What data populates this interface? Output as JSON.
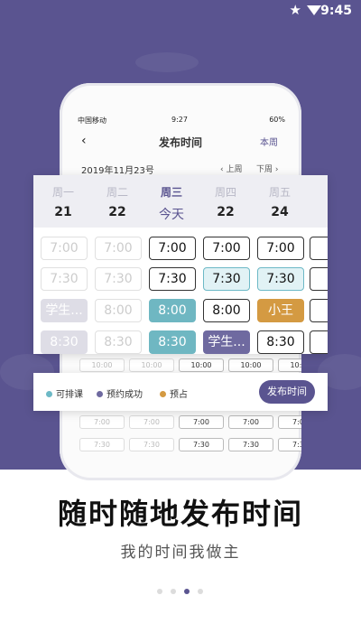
{
  "status_bar": {
    "time": "9:45"
  },
  "phone": {
    "status": {
      "carrier": "中国移动",
      "time": "9:27",
      "battery": "60%"
    },
    "nav": {
      "back": "‹",
      "title": "发布时间",
      "week": "本周"
    },
    "date": "2019年11月23号",
    "prev": "‹ 上周",
    "next": "下周 ›",
    "rows": [
      [
        "10:00",
        "10:00",
        "10:00",
        "10:00",
        "10:00",
        "1("
      ],
      [
        "7:00",
        "7:00",
        "7:00",
        "7:00",
        "7:00",
        "7"
      ],
      [
        "7:30",
        "7:30",
        "7:30",
        "7:30",
        "7:30",
        "7"
      ]
    ]
  },
  "schedule": {
    "days": [
      {
        "weekday": "周一",
        "day": "21"
      },
      {
        "weekday": "周二",
        "day": "22"
      },
      {
        "weekday": "周三",
        "day": "今天"
      },
      {
        "weekday": "周四",
        "day": "22"
      },
      {
        "weekday": "周五",
        "day": "24"
      },
      {
        "weekday": "周",
        "day": ""
      }
    ],
    "rows": [
      [
        "7:00",
        "7:00",
        "7:00",
        "7:00",
        "7:00",
        "7"
      ],
      [
        "7:30",
        "7:30",
        "7:30",
        "7:30",
        "7:30",
        "7"
      ],
      [
        "学生...",
        "8:00",
        "8:00",
        "8:00",
        "小王",
        "8"
      ],
      [
        "8:30",
        "8:30",
        "8:30",
        "学生...",
        "8:30",
        "8"
      ]
    ]
  },
  "legend": {
    "items": [
      {
        "label": "可排课",
        "color": "#6db9c6"
      },
      {
        "label": "预约成功",
        "color": "#6f6aa0"
      },
      {
        "label": "预占",
        "color": "#d49a42"
      }
    ],
    "publish_button": "发布时间"
  },
  "headline": "随时随地发布时间",
  "subline": "我的时间我做主",
  "colors": {
    "brand": "#5a5490",
    "scheduled": "#6db9c6",
    "reserved": "#d49a42"
  }
}
